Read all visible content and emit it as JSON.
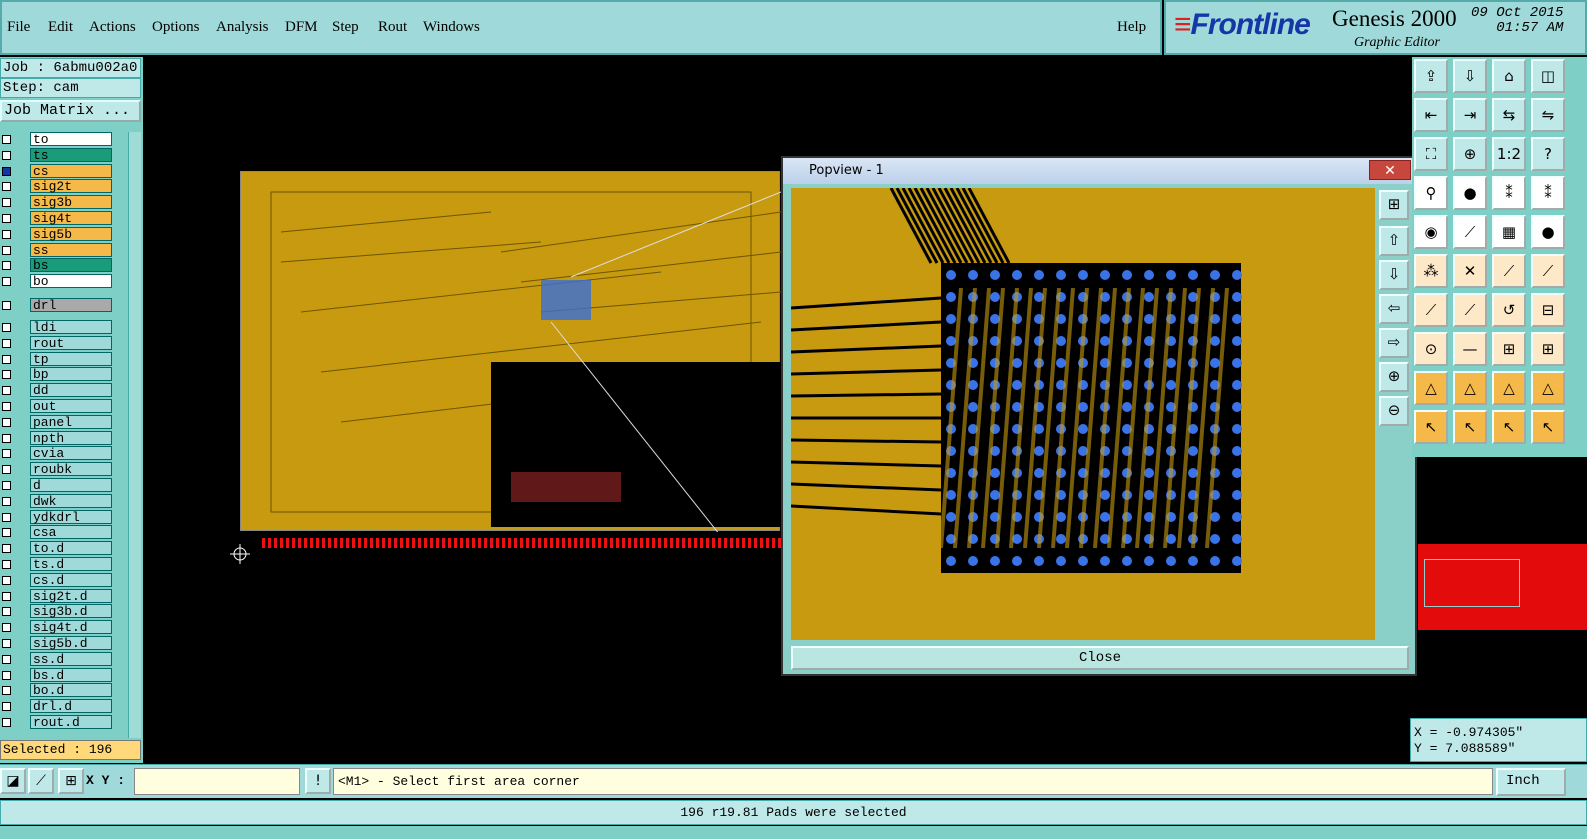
{
  "menubar": {
    "items": [
      "File",
      "Edit",
      "Actions",
      "Options",
      "Analysis",
      "DFM",
      "Step",
      "Rout",
      "Windows"
    ],
    "help": "Help"
  },
  "brand": {
    "logo": "Frontline",
    "product": "Genesis 2000",
    "subtitle": "Graphic Editor",
    "date": "09 Oct 2015",
    "time": "01:57 AM"
  },
  "job": {
    "job_label": "Job : 6abmu002a0",
    "step_label": "Step: cam",
    "matrix_button": "Job Matrix ..."
  },
  "layers": [
    {
      "name": "to",
      "color": "#ffffff"
    },
    {
      "name": "ts",
      "color": "#1a9b7a"
    },
    {
      "name": "cs",
      "color": "#f5b94a",
      "active": true
    },
    {
      "name": "sig2t",
      "color": "#f5b94a"
    },
    {
      "name": "sig3b",
      "color": "#f5b94a"
    },
    {
      "name": "sig4t",
      "color": "#f5b94a"
    },
    {
      "name": "sig5b",
      "color": "#f5b94a"
    },
    {
      "name": "ss",
      "color": "#f5b94a"
    },
    {
      "name": "bs",
      "color": "#1a9b7a"
    },
    {
      "name": "bo",
      "color": "#ffffff"
    },
    {
      "name": "drl",
      "color": "#a9a9a9"
    },
    {
      "name": "ldi",
      "color": "#9fd9d9"
    },
    {
      "name": "rout",
      "color": "#9fd9d9"
    },
    {
      "name": "tp",
      "color": "#9fd9d9"
    },
    {
      "name": "bp",
      "color": "#9fd9d9"
    },
    {
      "name": "dd",
      "color": "#9fd9d9"
    },
    {
      "name": "out",
      "color": "#9fd9d9"
    },
    {
      "name": "panel",
      "color": "#9fd9d9"
    },
    {
      "name": "npth",
      "color": "#9fd9d9"
    },
    {
      "name": "cvia",
      "color": "#9fd9d9"
    },
    {
      "name": "roubk",
      "color": "#9fd9d9"
    },
    {
      "name": "d",
      "color": "#9fd9d9"
    },
    {
      "name": "dwk",
      "color": "#9fd9d9"
    },
    {
      "name": "ydkdrl",
      "color": "#9fd9d9"
    },
    {
      "name": "csa",
      "color": "#9fd9d9"
    },
    {
      "name": "to.d",
      "color": "#9fd9d9"
    },
    {
      "name": "ts.d",
      "color": "#9fd9d9"
    },
    {
      "name": "cs.d",
      "color": "#9fd9d9"
    },
    {
      "name": "sig2t.d",
      "color": "#9fd9d9"
    },
    {
      "name": "sig3b.d",
      "color": "#9fd9d9"
    },
    {
      "name": "sig4t.d",
      "color": "#9fd9d9"
    },
    {
      "name": "sig5b.d",
      "color": "#9fd9d9"
    },
    {
      "name": "ss.d",
      "color": "#9fd9d9"
    },
    {
      "name": "bs.d",
      "color": "#9fd9d9"
    },
    {
      "name": "bo.d",
      "color": "#9fd9d9"
    },
    {
      "name": "drl.d",
      "color": "#9fd9d9"
    },
    {
      "name": "rout.d",
      "color": "#9fd9d9"
    }
  ],
  "selected": "Selected : 196",
  "popview": {
    "title": "Popview - 1",
    "close_label": "Close"
  },
  "coords": {
    "x": "X = -0.974305\"",
    "y": "Y = 7.088589\""
  },
  "bottom": {
    "xy_label": "X Y :",
    "xy_value": "",
    "prompt": "<M1> - Select first area corner",
    "unit": "Inch"
  },
  "status": "196 r19.81 Pads were selected"
}
